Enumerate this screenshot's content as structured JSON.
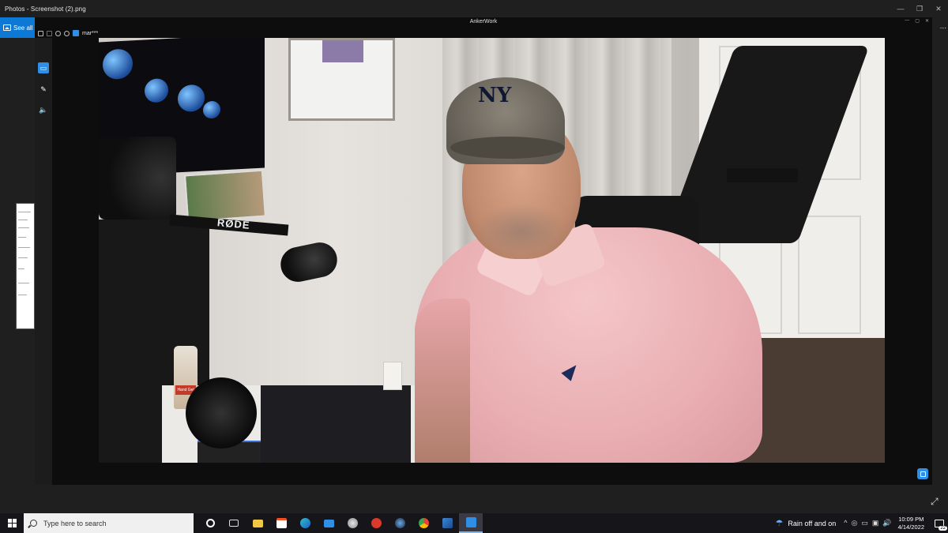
{
  "photos": {
    "title": "Photos - Screenshot (2).png",
    "see_all": "See all",
    "controls": {
      "minimize": "—",
      "restore": "❐",
      "close": "✕"
    }
  },
  "anker": {
    "title": "AnkerWork",
    "user_name": "mar***",
    "more": "...",
    "controls": {
      "minimize": "—",
      "maximize": "▢",
      "close": "✕"
    },
    "sidebar": [
      {
        "name": "camera",
        "glyph": "▭"
      },
      {
        "name": "edit",
        "glyph": "✎"
      },
      {
        "name": "audio",
        "glyph": "🔈"
      }
    ]
  },
  "video": {
    "cap_text": "NY",
    "mic_arm_label": "RØDE",
    "bottle_label": "Hand Gel"
  },
  "taskbar": {
    "search_placeholder": "Type here to search",
    "apps": [
      {
        "name": "cortana",
        "color": "#ffffff"
      },
      {
        "name": "task-view",
        "color": "#dddddd"
      },
      {
        "name": "file-explorer",
        "color": "#f2c744"
      },
      {
        "name": "store",
        "color": "#ffffff"
      },
      {
        "name": "edge",
        "color": "#2ec0c9"
      },
      {
        "name": "mail",
        "color": "#2f8fe6"
      },
      {
        "name": "app-people",
        "color": "#e5e5e5"
      },
      {
        "name": "app-red",
        "color": "#d93a2b"
      },
      {
        "name": "steam",
        "color": "#6aa9e8"
      },
      {
        "name": "chrome",
        "color": "#3aa757"
      },
      {
        "name": "photos",
        "color": "#3a86d8"
      },
      {
        "name": "ankerwork",
        "color": "#2f8fe6"
      }
    ],
    "weather": "Rain off and on",
    "time": "10:09 PM",
    "date": "4/14/2022",
    "notification_count": "22"
  },
  "colors": {
    "accent": "#2f8fe6",
    "taskbar_bg": "#15151a",
    "window_bg": "#0d0d0d"
  }
}
